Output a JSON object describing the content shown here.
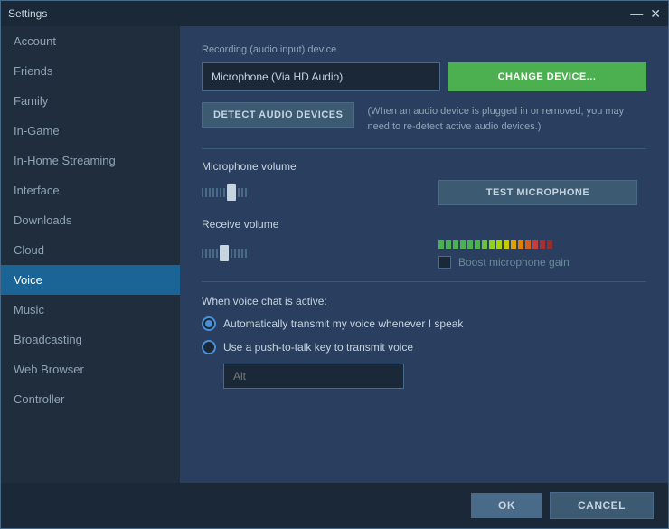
{
  "window": {
    "title": "Settings",
    "close_label": "✕",
    "minimize_label": "—"
  },
  "sidebar": {
    "items": [
      {
        "id": "account",
        "label": "Account",
        "active": false
      },
      {
        "id": "friends",
        "label": "Friends",
        "active": false
      },
      {
        "id": "family",
        "label": "Family",
        "active": false
      },
      {
        "id": "in-game",
        "label": "In-Game",
        "active": false
      },
      {
        "id": "in-home-streaming",
        "label": "In-Home Streaming",
        "active": false
      },
      {
        "id": "interface",
        "label": "Interface",
        "active": false
      },
      {
        "id": "downloads",
        "label": "Downloads",
        "active": false
      },
      {
        "id": "cloud",
        "label": "Cloud",
        "active": false
      },
      {
        "id": "voice",
        "label": "Voice",
        "active": true
      },
      {
        "id": "music",
        "label": "Music",
        "active": false
      },
      {
        "id": "broadcasting",
        "label": "Broadcasting",
        "active": false
      },
      {
        "id": "web-browser",
        "label": "Web Browser",
        "active": false
      },
      {
        "id": "controller",
        "label": "Controller",
        "active": false
      }
    ]
  },
  "content": {
    "recording_label": "Recording (audio input) device",
    "device_value": "Microphone (Via HD Audio)",
    "change_device_label": "CHANGE DEVICE...",
    "detect_label": "DETECT AUDIO DEVICES",
    "detect_note": "(When an audio device is plugged in or removed, you may need to re-detect active audio devices.)",
    "microphone_volume_label": "Microphone volume",
    "test_mic_label": "TEST MICROPHONE",
    "receive_volume_label": "Receive volume",
    "boost_label": "Boost microphone gain",
    "when_active_label": "When voice chat is active:",
    "radio_auto_label": "Automatically transmit my voice whenever I speak",
    "radio_push_label": "Use a push-to-talk key to transmit voice",
    "push_placeholder": "Alt"
  },
  "footer": {
    "ok_label": "OK",
    "cancel_label": "CANCEL"
  }
}
